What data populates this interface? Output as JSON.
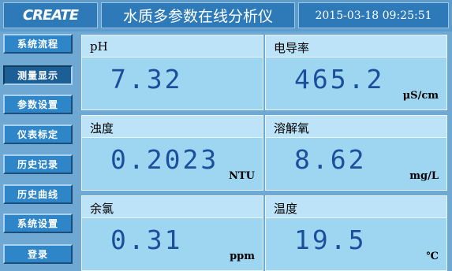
{
  "header": {
    "logo_text": "CREATE",
    "title": "水质多参数在线分析仪",
    "datetime": "2015-03-18 09:25:51"
  },
  "nav": {
    "items": [
      {
        "label": "系统流程",
        "active": false
      },
      {
        "label": "测量显示",
        "active": true
      },
      {
        "label": "参数设置",
        "active": false
      },
      {
        "label": "仪表标定",
        "active": false
      },
      {
        "label": "历史记录",
        "active": false
      },
      {
        "label": "历史曲线",
        "active": false
      },
      {
        "label": "系统设置",
        "active": false
      },
      {
        "label": "登录",
        "active": false
      }
    ]
  },
  "readings": [
    {
      "label": "pH",
      "value": "7.32",
      "unit": ""
    },
    {
      "label": "电导率",
      "value": "465.2",
      "unit": "μS/cm"
    },
    {
      "label": "浊度",
      "value": "0.2023",
      "unit": "NTU"
    },
    {
      "label": "溶解氧",
      "value": "8.62",
      "unit": "mg/L"
    },
    {
      "label": "余氯",
      "value": "0.31",
      "unit": "ppm"
    },
    {
      "label": "温度",
      "value": "19.5",
      "unit": "℃"
    }
  ],
  "colors": {
    "background": "#6fa8d3",
    "title_bar": "#2e7ab8",
    "panel": "#9ed5f1",
    "value_text": "#1b4f9c"
  }
}
